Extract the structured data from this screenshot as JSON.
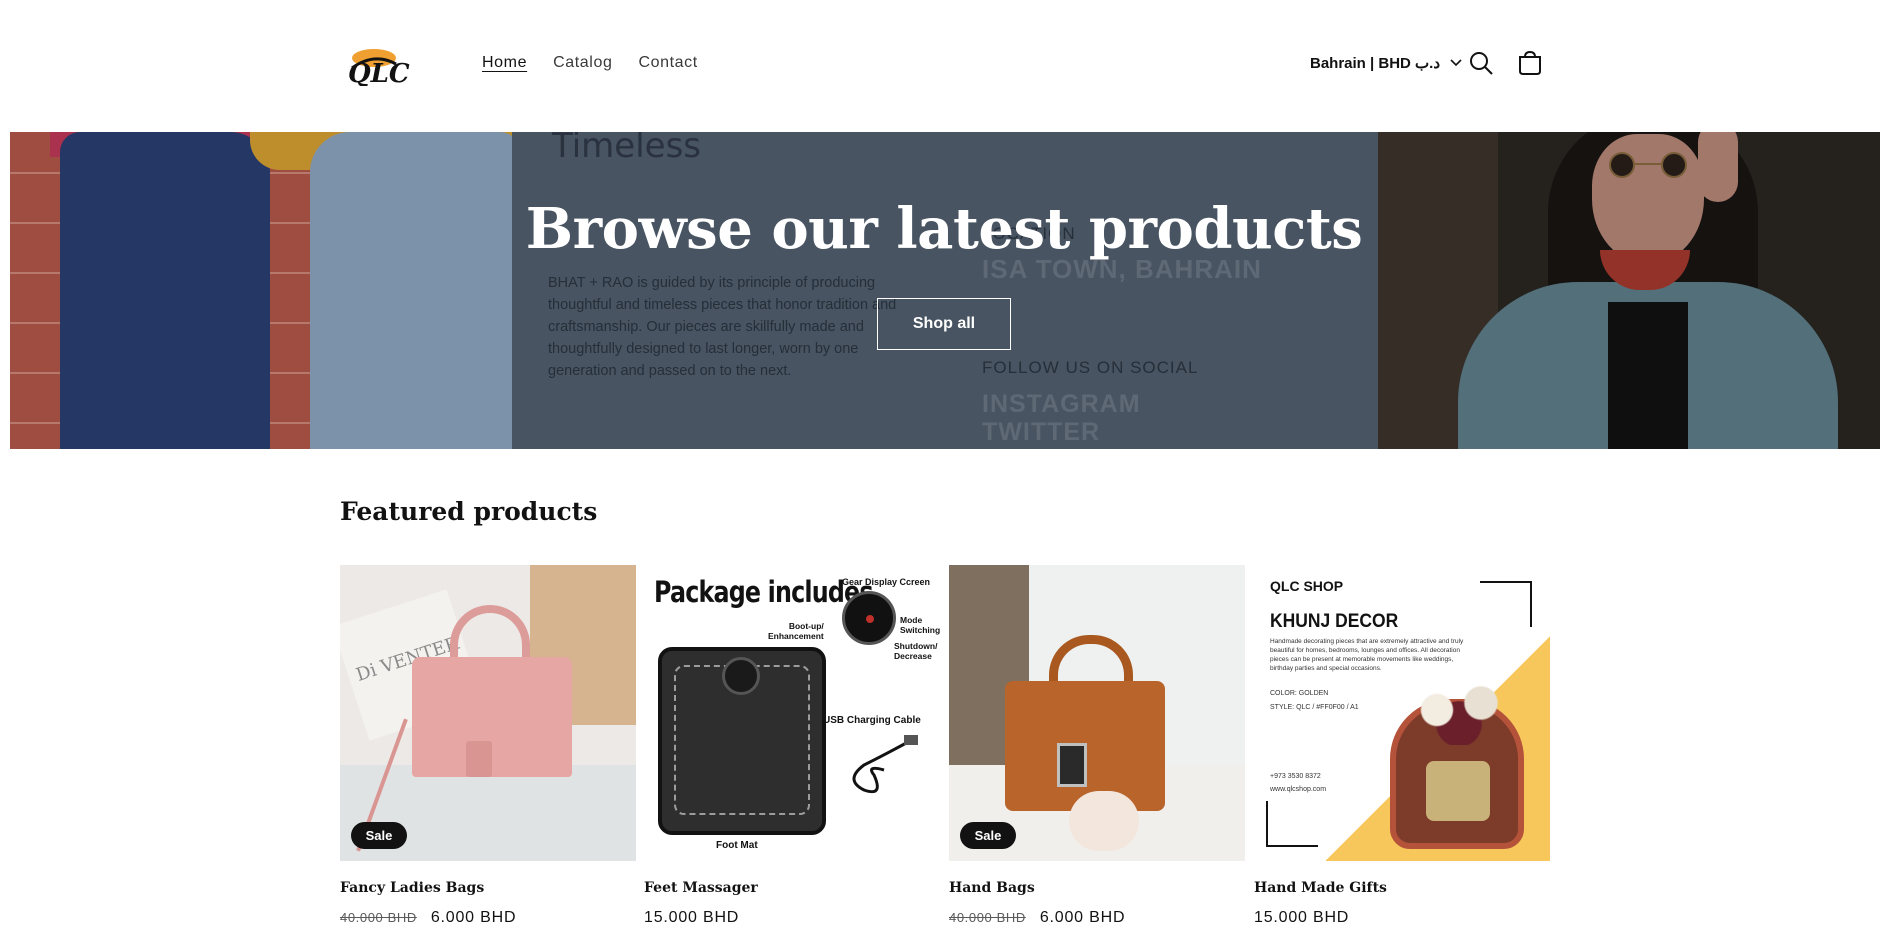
{
  "header": {
    "logo_alt": "QLC",
    "nav": [
      {
        "label": "Home",
        "active": true
      },
      {
        "label": "Catalog",
        "active": false
      },
      {
        "label": "Contact",
        "active": false
      }
    ],
    "locale": "Bahrain | BHD د.ب",
    "icons": {
      "search": "search-icon",
      "cart": "cart-icon",
      "chevron": "chevron-down-icon"
    }
  },
  "hero": {
    "heading": "Browse our latest products",
    "button": "Shop all",
    "image_text": {
      "title": "Timeless",
      "paragraph": "BHAT + RAO is guided by its principle of producing thoughtful and timeless pieces that honor tradition and craftsmanship. Our pieces are skillfully made and thoughtfully designed to last longer, worn by one generation and passed on to the next.",
      "location_label": "LOCATION",
      "location": "ISA TOWN, BAHRAIN",
      "follow": "FOLLOW US ON SOCIAL",
      "social_1": "INSTAGRAM",
      "social_2": "TWITTER"
    }
  },
  "featured": {
    "title": "Featured products",
    "products": [
      {
        "title": "Fancy Ladies Bags",
        "price_old": "40.000 BHD",
        "price": "6.000 BHD",
        "badge": "Sale",
        "image_text": "Di VENTER"
      },
      {
        "title": "Feet Massager",
        "price_old": "",
        "price": "15.000 BHD",
        "badge": "",
        "image_text": {
          "heading": "Package includes",
          "gear": "Gear Display Ccreen",
          "bootup": "Boot-up/\nEnhancement",
          "mode": "Mode\nSwitching",
          "shutdown": "Shutdown/\nDecrease",
          "usb": "USB Charging Cable",
          "footmat": "Foot Mat"
        }
      },
      {
        "title": "Hand Bags",
        "price_old": "40.000 BHD",
        "price": "6.000 BHD",
        "badge": "Sale"
      },
      {
        "title": "Hand Made Gifts",
        "price_old": "",
        "price": "15.000 BHD",
        "badge": "",
        "image_text": {
          "brand": "QLC SHOP",
          "heading": "KHUNJ DECOR",
          "desc": "Handmade decorating pieces that are extremely attractive and truly beautiful for homes, bedrooms, lounges and offices. All decoration pieces can be present at memorable movements like weddings, birthday parties and special occasions.",
          "color": "COLOR:  GOLDEN",
          "style": "STYLE:  QLC / #FF0F00 / A1",
          "phone": "+973 3530 8372",
          "web": "www.qlcshop.com"
        }
      }
    ]
  },
  "colors": {
    "accent": "#121212",
    "hero_overlay": "#52606f",
    "sale_badge": "#121212"
  }
}
